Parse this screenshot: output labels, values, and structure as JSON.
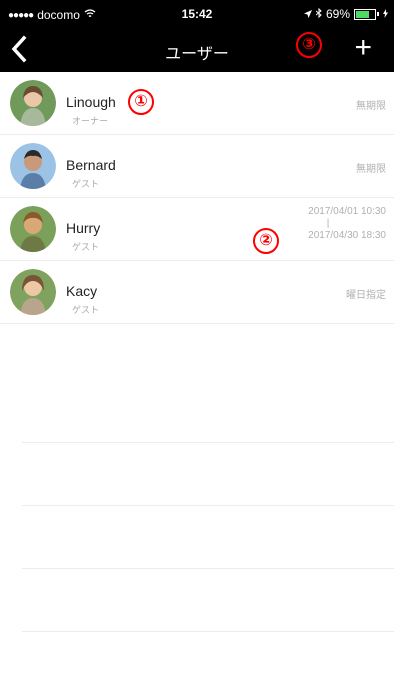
{
  "status": {
    "carrier": "docomo",
    "time": "15:42",
    "battery": "69%"
  },
  "nav": {
    "back_icon": "‹",
    "title": "ユーザー",
    "add_icon": "+",
    "callout": "③"
  },
  "users": [
    {
      "name": "Linough",
      "role": "オーナー",
      "right": "無期限",
      "callout": "①"
    },
    {
      "name": "Bernard",
      "role": "ゲスト",
      "right": "無期限"
    },
    {
      "name": "Hurry",
      "role": "ゲスト",
      "right_start": "2017/04/01 10:30",
      "right_sep": "|",
      "right_end": "2017/04/30 18:30",
      "callout": "②"
    },
    {
      "name": "Kacy",
      "role": "ゲスト",
      "right": "曜日指定"
    }
  ]
}
